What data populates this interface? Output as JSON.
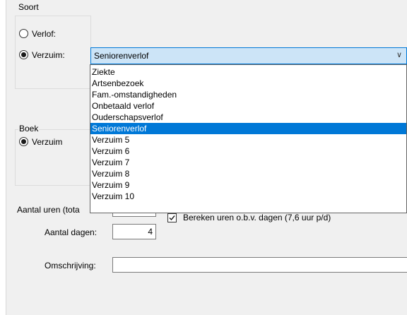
{
  "soort": {
    "legend": "Soort",
    "verlof_label": "Verlof:",
    "verzuim_label": "Verzuim:",
    "selected_value": "Seniorenverlof",
    "options": [
      "Ziekte",
      "Artsenbezoek",
      "Fam.-omstandigheden",
      "Onbetaald verlof",
      "Ouderschapsverlof",
      "Seniorenverlof",
      "Verzuim 5",
      "Verzuim 6",
      "Verzuim 7",
      "Verzuim 8",
      "Verzuim 9",
      "Verzuim 10"
    ],
    "highlighted_index": 5
  },
  "boek": {
    "legend": "Boek",
    "verzuim_label": "Verzuim"
  },
  "aantal_uren_label": "Aantal uren (tota",
  "bereken_label": "Bereken uren o.b.v. dagen (7,6 uur p/d)",
  "bereken_checked": true,
  "aantal_dagen": {
    "label": "Aantal dagen:",
    "value": "4"
  },
  "omschrijving": {
    "label": "Omschrijving:",
    "value": ""
  },
  "colors": {
    "accent": "#0078d7",
    "panel": "#f0f0f0"
  },
  "icons": {
    "combo_arrow": "chevron-down-icon",
    "checkmark": "checkmark-icon"
  }
}
